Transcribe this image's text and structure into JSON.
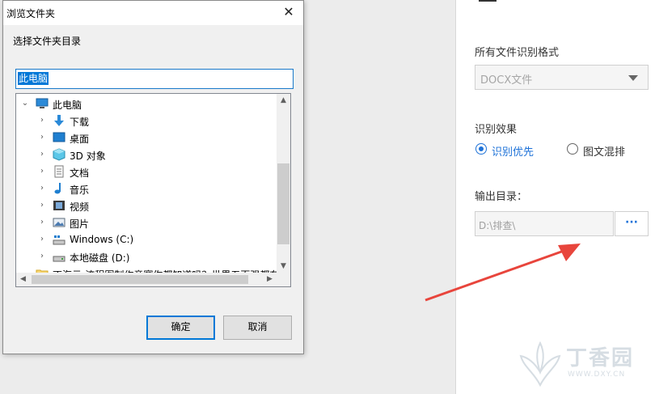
{
  "dialog": {
    "title": "浏览文件夹",
    "instruction": "选择文件夹目录",
    "path_value": "此电脑",
    "ok_label": "确定",
    "cancel_label": "取消",
    "tree": [
      {
        "label": "此电脑",
        "icon": "computer-icon",
        "level": 0,
        "expanded": true
      },
      {
        "label": "下载",
        "icon": "download-icon",
        "level": 1
      },
      {
        "label": "桌面",
        "icon": "desktop-icon",
        "level": 1
      },
      {
        "label": "3D 对象",
        "icon": "3d-objects-icon",
        "level": 1
      },
      {
        "label": "文档",
        "icon": "documents-icon",
        "level": 1
      },
      {
        "label": "音乐",
        "icon": "music-icon",
        "level": 1
      },
      {
        "label": "视频",
        "icon": "video-icon",
        "level": 1
      },
      {
        "label": "图片",
        "icon": "pictures-icon",
        "level": 1
      },
      {
        "label": "Windows (C:)",
        "icon": "windows-drive-icon",
        "level": 1
      },
      {
        "label": "本地磁盘 (D:)",
        "icon": "local-disk-icon",
        "level": 1
      },
      {
        "label": "丁海云-流程图制作竞赛你都知道吗？世界五百强都在",
        "icon": "folder-icon",
        "level": 0
      }
    ]
  },
  "settings": {
    "format_label": "所有文件识别格式",
    "format_value": "DOCX文件",
    "effect_label": "识别效果",
    "effect_options": [
      "识别优先",
      "图文混排"
    ],
    "effect_selected": 0,
    "output_label": "输出目录：",
    "output_path": "D:\\排查\\",
    "browse_label": "···"
  },
  "colors": {
    "accent": "#1e72d8",
    "selection": "#0078d7",
    "arrow": "#e8453c"
  }
}
